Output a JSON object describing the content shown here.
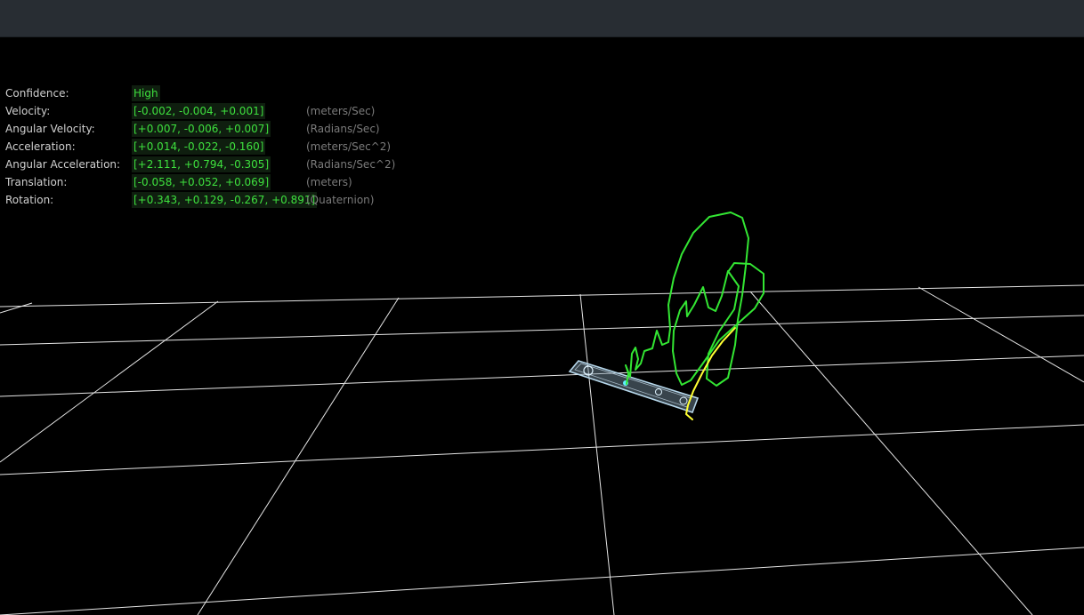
{
  "pose": {
    "rows": [
      {
        "label": "Confidence:",
        "value": "High",
        "unit": ""
      },
      {
        "label": "Velocity:",
        "value": "[-0.002, -0.004, +0.001]",
        "unit": "(meters/Sec)"
      },
      {
        "label": "Angular Velocity:",
        "value": "[+0.007, -0.006, +0.007]",
        "unit": "(Radians/Sec)"
      },
      {
        "label": "Acceleration:",
        "value": "[+0.014, -0.022, -0.160]",
        "unit": "(meters/Sec^2)"
      },
      {
        "label": "Angular Acceleration:",
        "value": "[+2.111, +0.794, -0.305]",
        "unit": "(Radians/Sec^2)"
      },
      {
        "label": "Translation:",
        "value": "[-0.058, +0.052, +0.069]",
        "unit": "(meters)"
      },
      {
        "label": "Rotation:",
        "value": "[+0.343, +0.129, -0.267, +0.891]",
        "unit": "(Quaternion)"
      }
    ]
  },
  "viewport": {
    "grid_color": "#e6e6e6",
    "trajectory_color": "#33e633",
    "recent_trajectory_color": "#ffff33",
    "device_icon": "tracking-camera-icon"
  }
}
